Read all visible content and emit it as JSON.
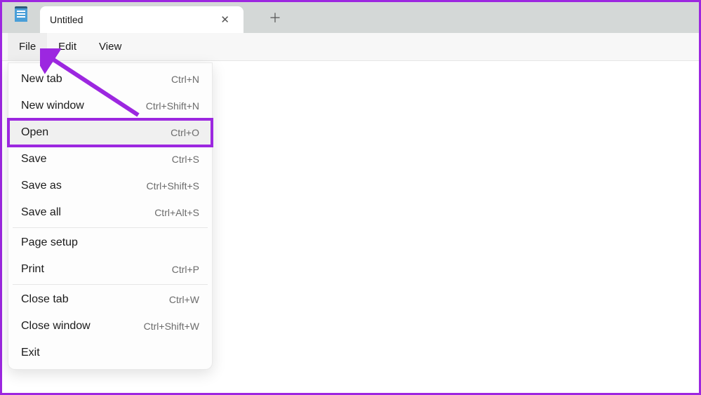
{
  "app": {
    "tab_title": "Untitled"
  },
  "menubar": {
    "items": [
      {
        "label": "File"
      },
      {
        "label": "Edit"
      },
      {
        "label": "View"
      }
    ]
  },
  "file_menu": {
    "groups": [
      [
        {
          "label": "New tab",
          "shortcut": "Ctrl+N",
          "highlighted": false
        },
        {
          "label": "New window",
          "shortcut": "Ctrl+Shift+N",
          "highlighted": false
        },
        {
          "label": "Open",
          "shortcut": "Ctrl+O",
          "highlighted": true
        },
        {
          "label": "Save",
          "shortcut": "Ctrl+S",
          "highlighted": false
        },
        {
          "label": "Save as",
          "shortcut": "Ctrl+Shift+S",
          "highlighted": false
        },
        {
          "label": "Save all",
          "shortcut": "Ctrl+Alt+S",
          "highlighted": false
        }
      ],
      [
        {
          "label": "Page setup",
          "shortcut": "",
          "highlighted": false
        },
        {
          "label": "Print",
          "shortcut": "Ctrl+P",
          "highlighted": false
        }
      ],
      [
        {
          "label": "Close tab",
          "shortcut": "Ctrl+W",
          "highlighted": false
        },
        {
          "label": "Close window",
          "shortcut": "Ctrl+Shift+W",
          "highlighted": false
        },
        {
          "label": "Exit",
          "shortcut": "",
          "highlighted": false
        }
      ]
    ]
  },
  "annotation": {
    "color": "#9c27e0"
  }
}
